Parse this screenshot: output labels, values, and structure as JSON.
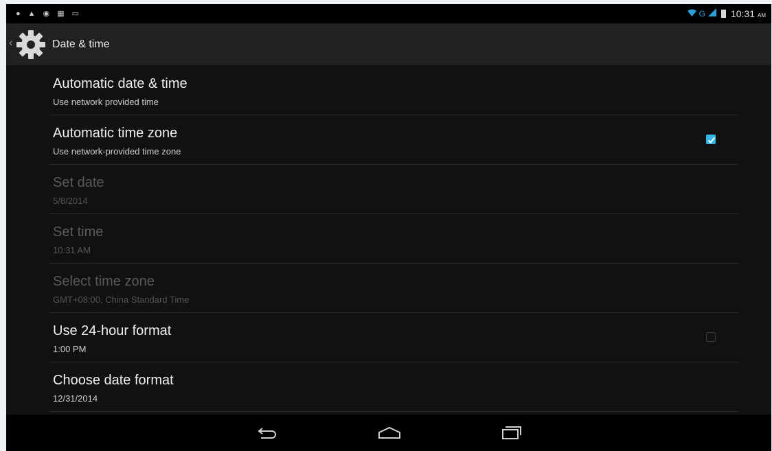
{
  "status_bar": {
    "time": "10:31",
    "ampm": "AM",
    "network_type": "G"
  },
  "action_bar": {
    "title": "Date & time"
  },
  "settings": [
    {
      "title": "Automatic date & time",
      "summary": "Use network provided time",
      "enabled": true
    },
    {
      "title": "Automatic time zone",
      "summary": "Use network-provided time zone",
      "enabled": true,
      "checked": true
    },
    {
      "title": "Set date",
      "summary": "5/8/2014",
      "enabled": false
    },
    {
      "title": "Set time",
      "summary": "10:31 AM",
      "enabled": false
    },
    {
      "title": "Select time zone",
      "summary": "GMT+08:00, China Standard Time",
      "enabled": false
    },
    {
      "title": "Use 24-hour format",
      "summary": "1:00 PM",
      "enabled": true,
      "checked": false
    },
    {
      "title": "Choose date format",
      "summary": "12/31/2014",
      "enabled": true
    }
  ],
  "icons": {
    "back": "back-icon",
    "home": "home-icon",
    "recents": "recents-icon",
    "settings": "gear-icon"
  },
  "colors": {
    "accent": "#33b5e5",
    "background": "#111111",
    "action_bar": "#212121"
  }
}
